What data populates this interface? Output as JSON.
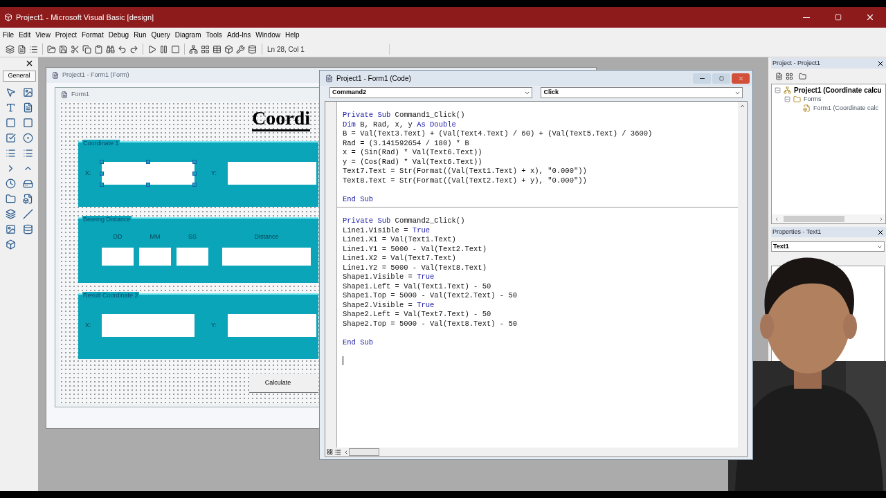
{
  "window": {
    "title": "Project1 - Microsoft Visual Basic [design]"
  },
  "menu": [
    "File",
    "Edit",
    "View",
    "Project",
    "Format",
    "Debug",
    "Run",
    "Query",
    "Diagram",
    "Tools",
    "Add-Ins",
    "Window",
    "Help"
  ],
  "toolbar": {
    "position": "Ln 28, Col 1"
  },
  "toolbox": {
    "tab": "General"
  },
  "form_designer": {
    "title": "Project1 - Form1 (Form)",
    "form_title": "Form1",
    "heading": "Coordi",
    "button": "Calculate",
    "frames": [
      {
        "title": "Coordinate 1",
        "kind": "xy",
        "fields": [
          {
            "label": "X:",
            "selected": true
          },
          {
            "label": "Y:",
            "selected": false
          }
        ]
      },
      {
        "title": "Bearing Distance",
        "kind": "bearing",
        "fields": [
          {
            "label": "DD",
            "selected": false
          },
          {
            "label": "MM",
            "selected": false
          },
          {
            "label": "SS",
            "selected": false
          },
          {
            "label": "Distance",
            "selected": false
          }
        ]
      },
      {
        "title": "Result Coordinate 2",
        "kind": "xy",
        "fields": [
          {
            "label": "X:",
            "selected": false
          },
          {
            "label": "Y:",
            "selected": false
          }
        ]
      }
    ]
  },
  "code_window": {
    "title": "Project1 - Form1 (Code)",
    "object": "Command2",
    "procedure": "Click",
    "procedures": [
      {
        "header": [
          {
            "kind": "keyword",
            "text": "Private Sub"
          },
          {
            "kind": "code",
            "text": " Command1_Click()"
          }
        ],
        "body": [
          [
            {
              "kind": "keyword",
              "text": "Dim"
            },
            {
              "kind": "code",
              "text": " B, Rad, x, y "
            },
            {
              "kind": "keyword",
              "text": "As Double"
            }
          ],
          [
            {
              "kind": "code",
              "text": "B = Val(Text3.Text) + (Val(Text4.Text) / 60) + (Val(Text5.Text) / 3600)"
            }
          ],
          [
            {
              "kind": "code",
              "text": "Rad = (3.141592654 / 180) * B"
            }
          ],
          [
            {
              "kind": "code",
              "text": "x = (Sin(Rad) * Val(Text6.Text))"
            }
          ],
          [
            {
              "kind": "code",
              "text": "y = (Cos(Rad) * Val(Text6.Text))"
            }
          ],
          [
            {
              "kind": "code",
              "text": "Text7.Text = Str(Format((Val(Text1.Text) + x), \"0.000\"))"
            }
          ],
          [
            {
              "kind": "code",
              "text": "Text8.Text = Str(Format((Val(Text2.Text) + y), \"0.000\"))"
            }
          ]
        ],
        "footer": [
          {
            "kind": "keyword",
            "text": "End Sub"
          }
        ]
      },
      {
        "header": [
          {
            "kind": "keyword",
            "text": "Private Sub"
          },
          {
            "kind": "code",
            "text": " Command2_Click()"
          }
        ],
        "body": [
          [
            {
              "kind": "code",
              "text": "Line1.Visible = "
            },
            {
              "kind": "keyword",
              "text": "True"
            }
          ],
          [
            {
              "kind": "code",
              "text": "Line1.X1 = Val(Text1.Text)"
            }
          ],
          [
            {
              "kind": "code",
              "text": "Line1.Y1 = 5000 - Val(Text2.Text)"
            }
          ],
          [
            {
              "kind": "code",
              "text": "Line1.X2 = Val(Text7.Text)"
            }
          ],
          [
            {
              "kind": "code",
              "text": "Line1.Y2 = 5000 - Val(Text8.Text)"
            }
          ],
          [
            {
              "kind": "code",
              "text": "Shape1.Visible = "
            },
            {
              "kind": "keyword",
              "text": "True"
            }
          ],
          [
            {
              "kind": "code",
              "text": "Shape1.Left = Val(Text1.Text) - 50"
            }
          ],
          [
            {
              "kind": "code",
              "text": "Shape1.Top = 5000 - Val(Text2.Text) - 50"
            }
          ],
          [
            {
              "kind": "code",
              "text": "Shape2.Visible = "
            },
            {
              "kind": "keyword",
              "text": "True"
            }
          ],
          [
            {
              "kind": "code",
              "text": "Shape2.Left = Val(Text7.Text) - 50"
            }
          ],
          [
            {
              "kind": "code",
              "text": "Shape2.Top = 5000 - Val(Text8.Text) - 50"
            }
          ]
        ],
        "footer": [
          {
            "kind": "keyword",
            "text": "End Sub"
          }
        ]
      }
    ]
  },
  "project_panel": {
    "title": "Project - Project1",
    "tree": [
      {
        "label": "Project1 (Coordinate calcu",
        "expanded": true,
        "children": [
          {
            "label": "Forms",
            "expanded": true,
            "children": [
              {
                "label": "Form1 (Coordinate calc"
              }
            ]
          }
        ]
      }
    ]
  },
  "properties_panel": {
    "title": "Properties - Text1",
    "object": "Text1"
  }
}
